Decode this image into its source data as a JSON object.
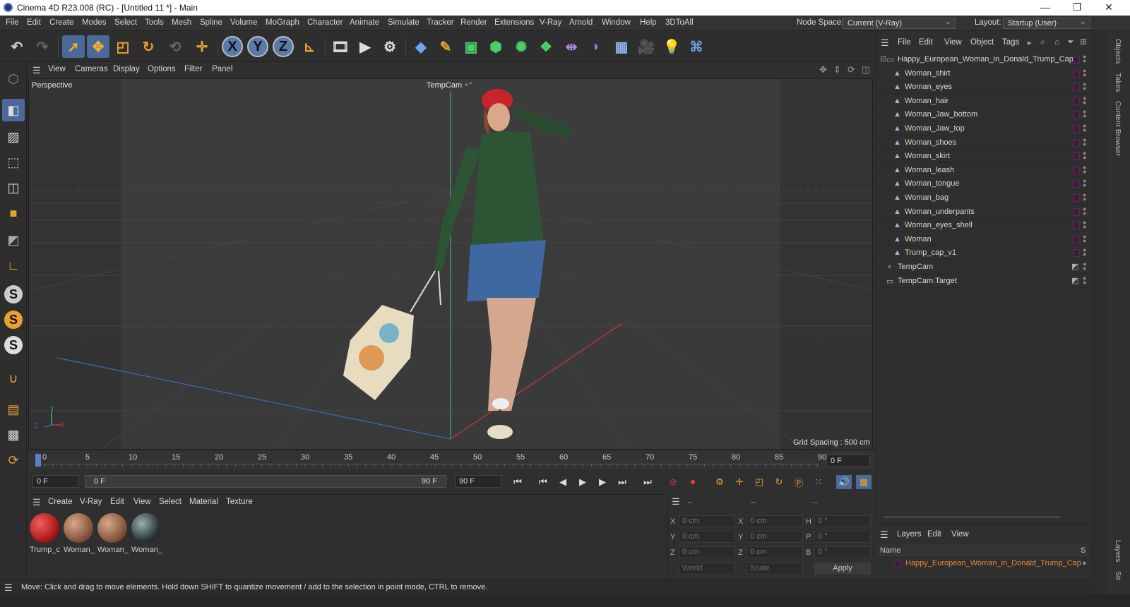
{
  "window": {
    "title": "Cinema 4D R23.008 (RC) - [Untitled 11 *] - Main",
    "minimize": "—",
    "restore": "❐",
    "close": "✕"
  },
  "menu": [
    "File",
    "Edit",
    "Create",
    "Modes",
    "Select",
    "Tools",
    "Mesh",
    "Spline",
    "Volume",
    "MoGraph",
    "Character",
    "Animate",
    "Simulate",
    "Tracker",
    "Render",
    "Extensions",
    "V-Ray",
    "Arnold",
    "Window",
    "Help",
    "3DToAll"
  ],
  "node_space": {
    "label": "Node Space:",
    "value": "Current (V-Ray)"
  },
  "layout": {
    "label": "Layout:",
    "value": "Startup (User)"
  },
  "toolbar": {
    "x_label": "X",
    "y_label": "Y",
    "z_label": "Z"
  },
  "viewport": {
    "menu": [
      "View",
      "Cameras",
      "Display",
      "Options",
      "Filter",
      "Panel"
    ],
    "name": "Perspective",
    "camera": "TempCam",
    "grid_spacing": "Grid Spacing : 500 cm",
    "axis": {
      "y": "Y",
      "z": "Z",
      "x": "X"
    }
  },
  "timeline": {
    "ticks": [
      "0",
      "5",
      "10",
      "15",
      "20",
      "25",
      "30",
      "35",
      "40",
      "45",
      "50",
      "55",
      "60",
      "65",
      "70",
      "75",
      "80",
      "85",
      "90"
    ],
    "current_frame_right": "0 F",
    "start": "0 F",
    "range_start": "0 F",
    "range_end": "90 F",
    "end": "90 F"
  },
  "material_panel": {
    "menu": [
      "Create",
      "V-Ray",
      "Edit",
      "View",
      "Select",
      "Material",
      "Texture"
    ],
    "materials": [
      {
        "label": "Trump_c",
        "color": "#b01a1a"
      },
      {
        "label": "Woman_",
        "color": "#8a5a40"
      },
      {
        "label": "Woman_",
        "color": "#8a5a40"
      },
      {
        "label": "Woman_",
        "color": "#2d3a3a"
      }
    ]
  },
  "coords": {
    "header": [
      "--",
      "--",
      "--"
    ],
    "rows": [
      {
        "a": "X",
        "av": "0 cm",
        "b": "X",
        "bv": "0 cm",
        "c": "H",
        "cv": "0 °"
      },
      {
        "a": "Y",
        "av": "0 cm",
        "b": "Y",
        "bv": "0 cm",
        "c": "P",
        "cv": "0 °"
      },
      {
        "a": "Z",
        "av": "0 cm",
        "b": "Z",
        "bv": "0 cm",
        "c": "B",
        "cv": "0 °"
      }
    ],
    "world": "World",
    "scale": "Scale",
    "apply": "Apply"
  },
  "objects_panel": {
    "menu": [
      "File",
      "Edit",
      "View",
      "Object",
      "Tags"
    ],
    "root": "Happy_European_Woman_in_Donald_Trump_Cap",
    "children": [
      "Woman_shirt",
      "Woman_eyes",
      "Woman_hair",
      "Woman_Jaw_bottom",
      "Woman_Jaw_top",
      "Woman_shoes",
      "Woman_skirt",
      "Woman_leash",
      "Woman_tongue",
      "Woman_bag",
      "Woman_underpants",
      "Woman_eyes_shell",
      "Woman",
      "Trump_cap_v1"
    ],
    "others": [
      "TempCam",
      "TempCam.Target"
    ]
  },
  "layers_panel": {
    "menu": [
      "Layers",
      "Edit",
      "View"
    ],
    "col_name": "Name",
    "col_s": "S",
    "layer": "Happy_European_Woman_in_Donald_Trump_Cap"
  },
  "side_tabs": [
    "Objects",
    "Takes",
    "Content Browser",
    "Layers",
    "Str"
  ],
  "status": "Move: Click and drag to move elements. Hold down SHIFT to quantize movement / add to the selection in point mode, CTRL to remove.",
  "colors": {
    "accent_blue": "#4b6a9a",
    "layer_orange": "#e8883a",
    "tool_orange": "#e8a030"
  }
}
